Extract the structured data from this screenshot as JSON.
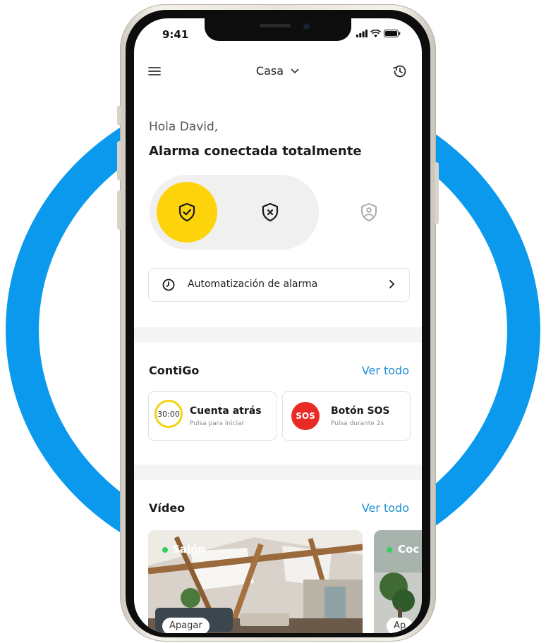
{
  "status_bar": {
    "time": "9:41"
  },
  "header": {
    "location": "Casa",
    "menu_icon": "hamburger-icon",
    "history_icon": "history-icon"
  },
  "greeting": "Hola David,",
  "alarm_status": "Alarma conectada totalmente",
  "modes": [
    {
      "id": "armed",
      "icon": "shield-check-icon",
      "active": true
    },
    {
      "id": "disarmed",
      "icon": "shield-x-icon",
      "active": false
    },
    {
      "id": "home",
      "icon": "shield-person-icon",
      "active": false
    }
  ],
  "automation": {
    "label": "Automatización de alarma"
  },
  "contigo": {
    "title": "ContiGo",
    "see_all": "Ver todo",
    "cards": [
      {
        "badge": "30:00",
        "title": "Cuenta atrás",
        "subtitle": "Pulsa para iniciar"
      },
      {
        "badge": "SOS",
        "title": "Botón SOS",
        "subtitle": "Pulsa durante 2s"
      }
    ]
  },
  "video": {
    "title": "Vídeo",
    "see_all": "Ver todo",
    "cameras": [
      {
        "name": "Salón",
        "action": "Apagar",
        "online": true
      },
      {
        "name": "Coc",
        "action": "Ap",
        "online": true
      }
    ]
  },
  "colors": {
    "brand_blue": "#0a99ec",
    "accent_yellow": "#fdd30c",
    "sos_red": "#ea2a25",
    "link_blue": "#1c8fd6"
  }
}
